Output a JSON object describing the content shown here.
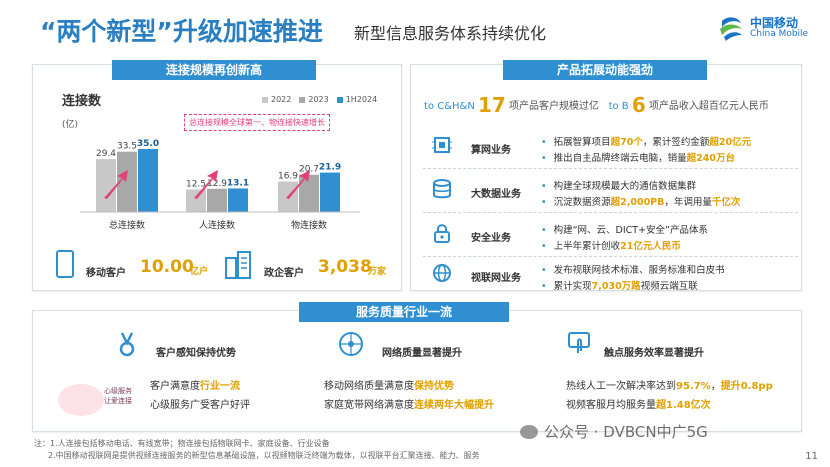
{
  "header": {
    "title_main": "“两个新型”升级加速推进",
    "title_sub": "新型信息服务体系持续优化",
    "logo_cn": "中国移动",
    "logo_en": "China Mobile"
  },
  "left_panel": {
    "banner": "连接规模再创新高",
    "chart_title": "连接数",
    "unit": "(亿)",
    "note": "总连接规模全球第一、物连接快速增长",
    "kpis": [
      {
        "label": "移动客户",
        "value": "10.00",
        "unit": "亿户"
      },
      {
        "label": "政企客户",
        "value": "3,038",
        "unit": "万家"
      }
    ]
  },
  "chart_data": {
    "type": "bar",
    "categories": [
      "总连接数",
      "人连接数",
      "物连接数"
    ],
    "series": [
      {
        "name": "2022",
        "values": [
          29.4,
          12.5,
          16.9
        ]
      },
      {
        "name": "2023",
        "values": [
          33.5,
          12.9,
          20.7
        ]
      },
      {
        "name": "1H2024",
        "values": [
          35.0,
          13.1,
          21.9
        ]
      }
    ],
    "value_labels": [
      [
        "29.4",
        "33.5",
        "35.0"
      ],
      [
        "12.5",
        "12.9",
        "13.1"
      ],
      [
        "16.9",
        "20.7",
        "21.9"
      ]
    ],
    "colors": [
      "#c8c8c8",
      "#a8a8a8",
      "#2f8fd1"
    ],
    "ylim": [
      0,
      40
    ]
  },
  "right_panel": {
    "banner": "产品拓展动能强劲",
    "headline": {
      "prefix": "to C&H&N",
      "num1": "17",
      "mid": "项产品客户规模过亿",
      "prefix2": "to B",
      "num2": "6",
      "suffix": "项产品收入超百亿元人民币"
    },
    "businesses": [
      {
        "name": "算网业务",
        "icon": "chip-icon",
        "lines": [
          [
            {
              "t": "拓展智算项目"
            },
            {
              "t": "超70个",
              "h": true
            },
            {
              "t": "，累计签约金额"
            },
            {
              "t": "超20亿元",
              "h": true
            }
          ],
          [
            {
              "t": "推出自主品牌终端云电脑，销量"
            },
            {
              "t": "超240万台",
              "h": true
            }
          ]
        ]
      },
      {
        "name": "大数据业务",
        "icon": "database-icon",
        "lines": [
          [
            {
              "t": "构建全球规模最大的通信数据集群"
            }
          ],
          [
            {
              "t": "沉淀数据资源"
            },
            {
              "t": "超2,000PB",
              "h": true
            },
            {
              "t": "，年调用量"
            },
            {
              "t": "千亿次",
              "h": true
            }
          ]
        ]
      },
      {
        "name": "安全业务",
        "icon": "lock-icon",
        "lines": [
          [
            {
              "t": "构建“网、云、DICT+安全”产品体系"
            }
          ],
          [
            {
              "t": "上半年累计创收"
            },
            {
              "t": "21亿元人民币",
              "h": true
            }
          ]
        ]
      },
      {
        "name": "视联网业务",
        "icon": "globe-icon",
        "lines": [
          [
            {
              "t": "发布视联网技术标准、服务标准和白皮书"
            }
          ],
          [
            {
              "t": "累计实现"
            },
            {
              "t": "7,030万路",
              "h": true
            },
            {
              "t": "视频云端互联"
            }
          ]
        ]
      }
    ]
  },
  "bottom_panel": {
    "banner": "服务质量行业一流",
    "badge_line1": "心级服务",
    "badge_line2": "让爱连接",
    "sections": [
      {
        "head": "客户感知保持优势",
        "icon": "medal-icon",
        "lines": [
          [
            {
              "t": "客户满意度"
            },
            {
              "t": "行业一流",
              "h": true
            }
          ],
          [
            {
              "t": "心级服务广受客户好评"
            }
          ]
        ]
      },
      {
        "head": "网络质量显著提升",
        "icon": "network-icon",
        "lines": [
          [
            {
              "t": "移动网络质量满意度"
            },
            {
              "t": "保持优势",
              "h": true
            }
          ],
          [
            {
              "t": "家庭宽带网络满意度"
            },
            {
              "t": "连续两年大幅提升",
              "h": true
            }
          ]
        ]
      },
      {
        "head": "触点服务效率显著提升",
        "icon": "touch-icon",
        "lines": [
          [
            {
              "t": "热线人工一次解决率达到"
            },
            {
              "t": "95.7%",
              "h": true
            },
            {
              "t": "，"
            },
            {
              "t": "提升0.8pp",
              "h": true
            }
          ],
          [
            {
              "t": "视频客服月均服务量"
            },
            {
              "t": "超1.48亿次",
              "h": true
            }
          ]
        ]
      }
    ]
  },
  "footnotes": [
    "注：1.人连接包括移动电话、有线宽带；物连接包括物联网卡、家庭设备、行业设备",
    "2.中国移动视联网是提供视频连接服务的新型信息基础设施，以视频物联泛终端为载体，以视联平台汇聚连接、能力、服务"
  ],
  "watermark": "公众号 · DVBCN中广5G",
  "page_number": "11"
}
